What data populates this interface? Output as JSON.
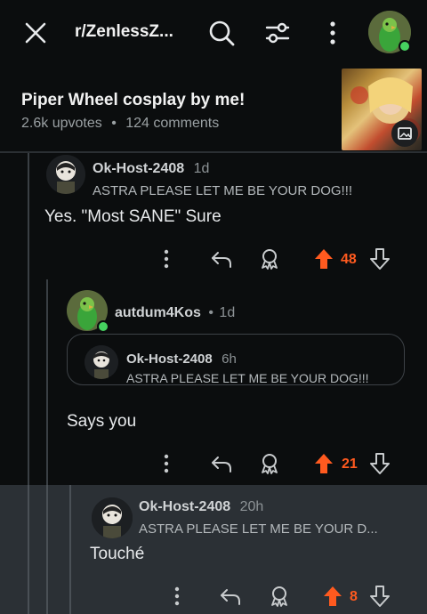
{
  "topbar": {
    "subreddit": "r/ZenlessZ...",
    "icons": [
      "close-icon",
      "search-icon",
      "filter-icon",
      "more-vertical-icon",
      "user-avatar"
    ]
  },
  "post": {
    "title": "Piper Wheel cosplay by me!",
    "upvotes": "2.6k upvotes",
    "separator": "•",
    "comments": "124 comments"
  },
  "comments": [
    {
      "username": "Ok-Host-2408",
      "time": "1d",
      "flair": "ASTRA PLEASE LET ME BE YOUR DOG!!!",
      "body": "Yes. \"Most SANE\" Sure",
      "votes": "48"
    },
    {
      "username": "autdum4Kos",
      "separator": "•",
      "time": "1d",
      "quote": {
        "username": "Ok-Host-2408",
        "time": "6h",
        "flair": "ASTRA PLEASE LET ME BE YOUR DOG!!!"
      },
      "body": "Says you",
      "votes": "21"
    },
    {
      "username": "Ok-Host-2408",
      "time": "20h",
      "flair": "ASTRA PLEASE LET ME BE YOUR D...",
      "body": "Touché",
      "votes": "8"
    }
  ],
  "colors": {
    "background": "#0b0d0e",
    "upvote_active": "#ff5a1f",
    "online": "#46d160",
    "highlight": "#2b3035"
  }
}
